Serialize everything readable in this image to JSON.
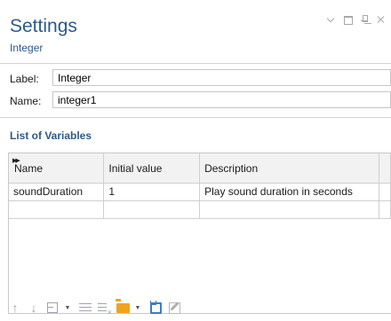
{
  "header": {
    "title": "Settings",
    "subtitle": "Integer"
  },
  "form": {
    "label_caption": "Label:",
    "label_value": "Integer",
    "name_caption": "Name:",
    "name_value": "integer1"
  },
  "variables": {
    "section_title": "List of Variables",
    "columns": [
      "Name",
      "Initial value",
      "Description"
    ],
    "rows": [
      [
        "soundDuration",
        "1",
        "Play sound duration in seconds"
      ],
      [
        "",
        "",
        ""
      ]
    ]
  },
  "toolbar": {
    "icons": [
      "arrow-up-icon",
      "arrow-down-icon",
      "add-column-icon",
      "list-icon",
      "clear-list-icon",
      "open-folder-icon",
      "save-icon",
      "edit-icon"
    ]
  }
}
